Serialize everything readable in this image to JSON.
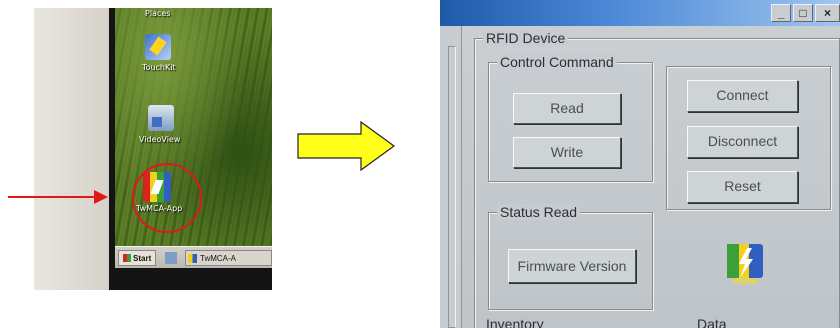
{
  "desktop": {
    "places_label": "Places",
    "icons": [
      {
        "label": "TouchKit"
      },
      {
        "label": "VideoView"
      },
      {
        "label": "TwMCA-App"
      }
    ],
    "taskbar": {
      "start_label": "Start",
      "app_label": "TwMCA-A"
    }
  },
  "app": {
    "window_buttons": {
      "minimize": "_",
      "maximize": "□",
      "close": "×"
    },
    "device_group_title": "RFID Device",
    "control_group_title": "Control Command",
    "read_button": "Read",
    "write_button": "Write",
    "connect_button": "Connect",
    "disconnect_button": "Disconnect",
    "reset_button": "Reset",
    "status_group_title": "Status Read",
    "firmware_button": "Firmware Version",
    "inventory_label": "Inventory",
    "data_label": "Data"
  },
  "colors": {
    "arrow_red": "#e01818",
    "arrow_yellow": "#ffff1a",
    "titlebar_blue": "#1d5aa8",
    "panel_gray": "#c6ccd0"
  }
}
